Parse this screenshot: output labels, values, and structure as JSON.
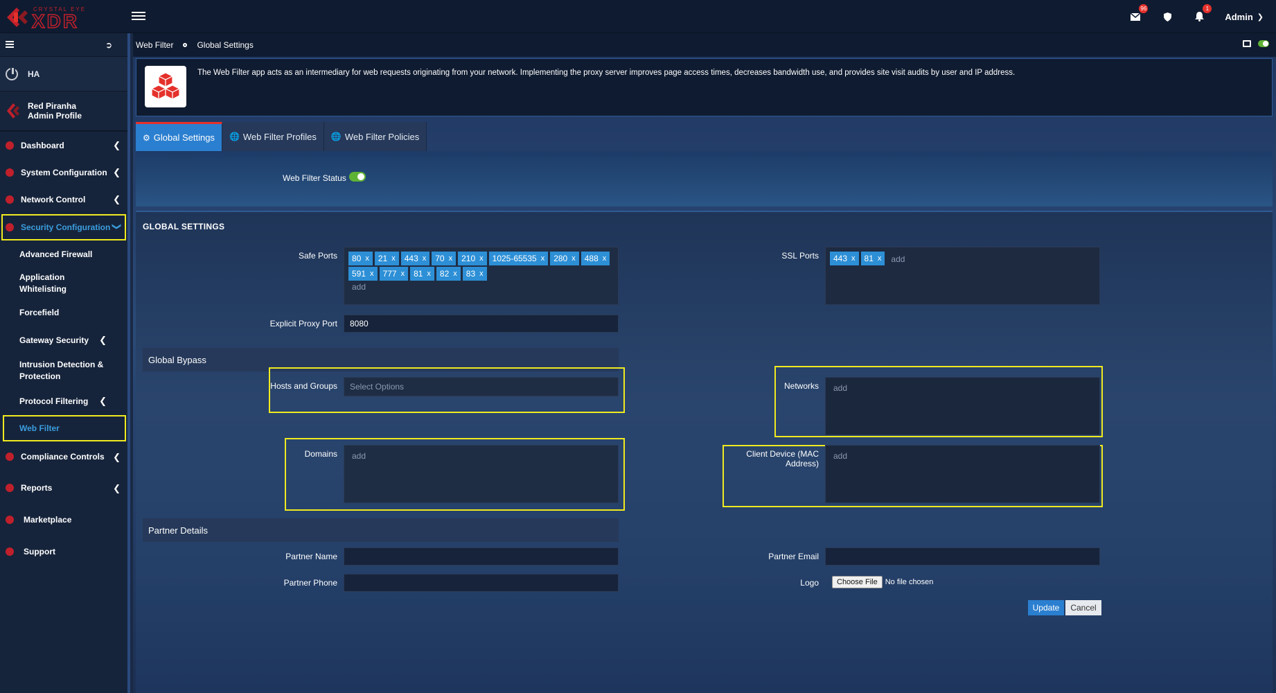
{
  "topbar": {
    "logo_top_text": "CRYSTAL EYE",
    "logo_main_text": "XDR",
    "mail_badge": "96",
    "bell_badge": "1",
    "admin_label": "Admin"
  },
  "sidebar": {
    "ha_label": "HA",
    "profile_name": "Red Piranha",
    "profile_sub": "Admin Profile",
    "items": [
      {
        "label": "Dashboard"
      },
      {
        "label": "System Configuration"
      },
      {
        "label": "Network Control"
      },
      {
        "label": "Security Configuration"
      },
      {
        "label": "Compliance Controls"
      },
      {
        "label": "Reports"
      },
      {
        "label": "Marketplace"
      },
      {
        "label": "Support"
      }
    ],
    "sub_items": [
      {
        "label": "Advanced Firewall"
      },
      {
        "label": "Application Whitelisting"
      },
      {
        "label": "Forcefield"
      },
      {
        "label": "Gateway Security"
      },
      {
        "label": "Intrusion Detection & Protection"
      },
      {
        "label": "Protocol Filtering"
      },
      {
        "label": "Web Filter"
      }
    ]
  },
  "breadcrumb": {
    "first": "Web Filter",
    "second": "Global Settings"
  },
  "info": {
    "description": "The Web Filter app acts as an intermediary for web requests originating from your network. Implementing the proxy server improves page access times, decreases bandwidth use, and provides site visit audits by user and IP address."
  },
  "tabs": [
    {
      "label": "Global Settings"
    },
    {
      "label": "Web Filter Profiles"
    },
    {
      "label": "Web Filter Policies"
    }
  ],
  "status": {
    "label": "Web Filter Status",
    "enabled": true
  },
  "settings": {
    "title": "GLOBAL SETTINGS",
    "safe_ports_label": "Safe Ports",
    "safe_ports": [
      "80",
      "21",
      "443",
      "70",
      "210",
      "1025-65535",
      "280",
      "488",
      "591",
      "777",
      "81",
      "82",
      "83"
    ],
    "ssl_ports_label": "SSL Ports",
    "ssl_ports": [
      "443",
      "81"
    ],
    "add_placeholder": "add",
    "tag_remove": "x",
    "explicit_proxy_label": "Explicit Proxy Port",
    "explicit_proxy_value": "8080",
    "global_bypass_title": "Global Bypass",
    "hosts_groups_label": "Hosts and Groups",
    "hosts_groups_placeholder": "Select Options",
    "networks_label": "Networks",
    "domains_label": "Domains",
    "client_device_label": "Client Device (MAC Address)",
    "partner_title": "Partner Details",
    "partner_name_label": "Partner Name",
    "partner_email_label": "Partner Email",
    "partner_phone_label": "Partner Phone",
    "logo_label": "Logo",
    "choose_file_label": "Choose File",
    "no_file_label": "No file chosen",
    "update_label": "Update",
    "cancel_label": "Cancel"
  },
  "colors": {
    "accent_blue": "#2b7fd0",
    "tag_blue": "#2d8fd6",
    "brand_red": "#c0202b",
    "highlight_yellow": "#f1ea1f",
    "toggle_green": "#5fb334"
  }
}
